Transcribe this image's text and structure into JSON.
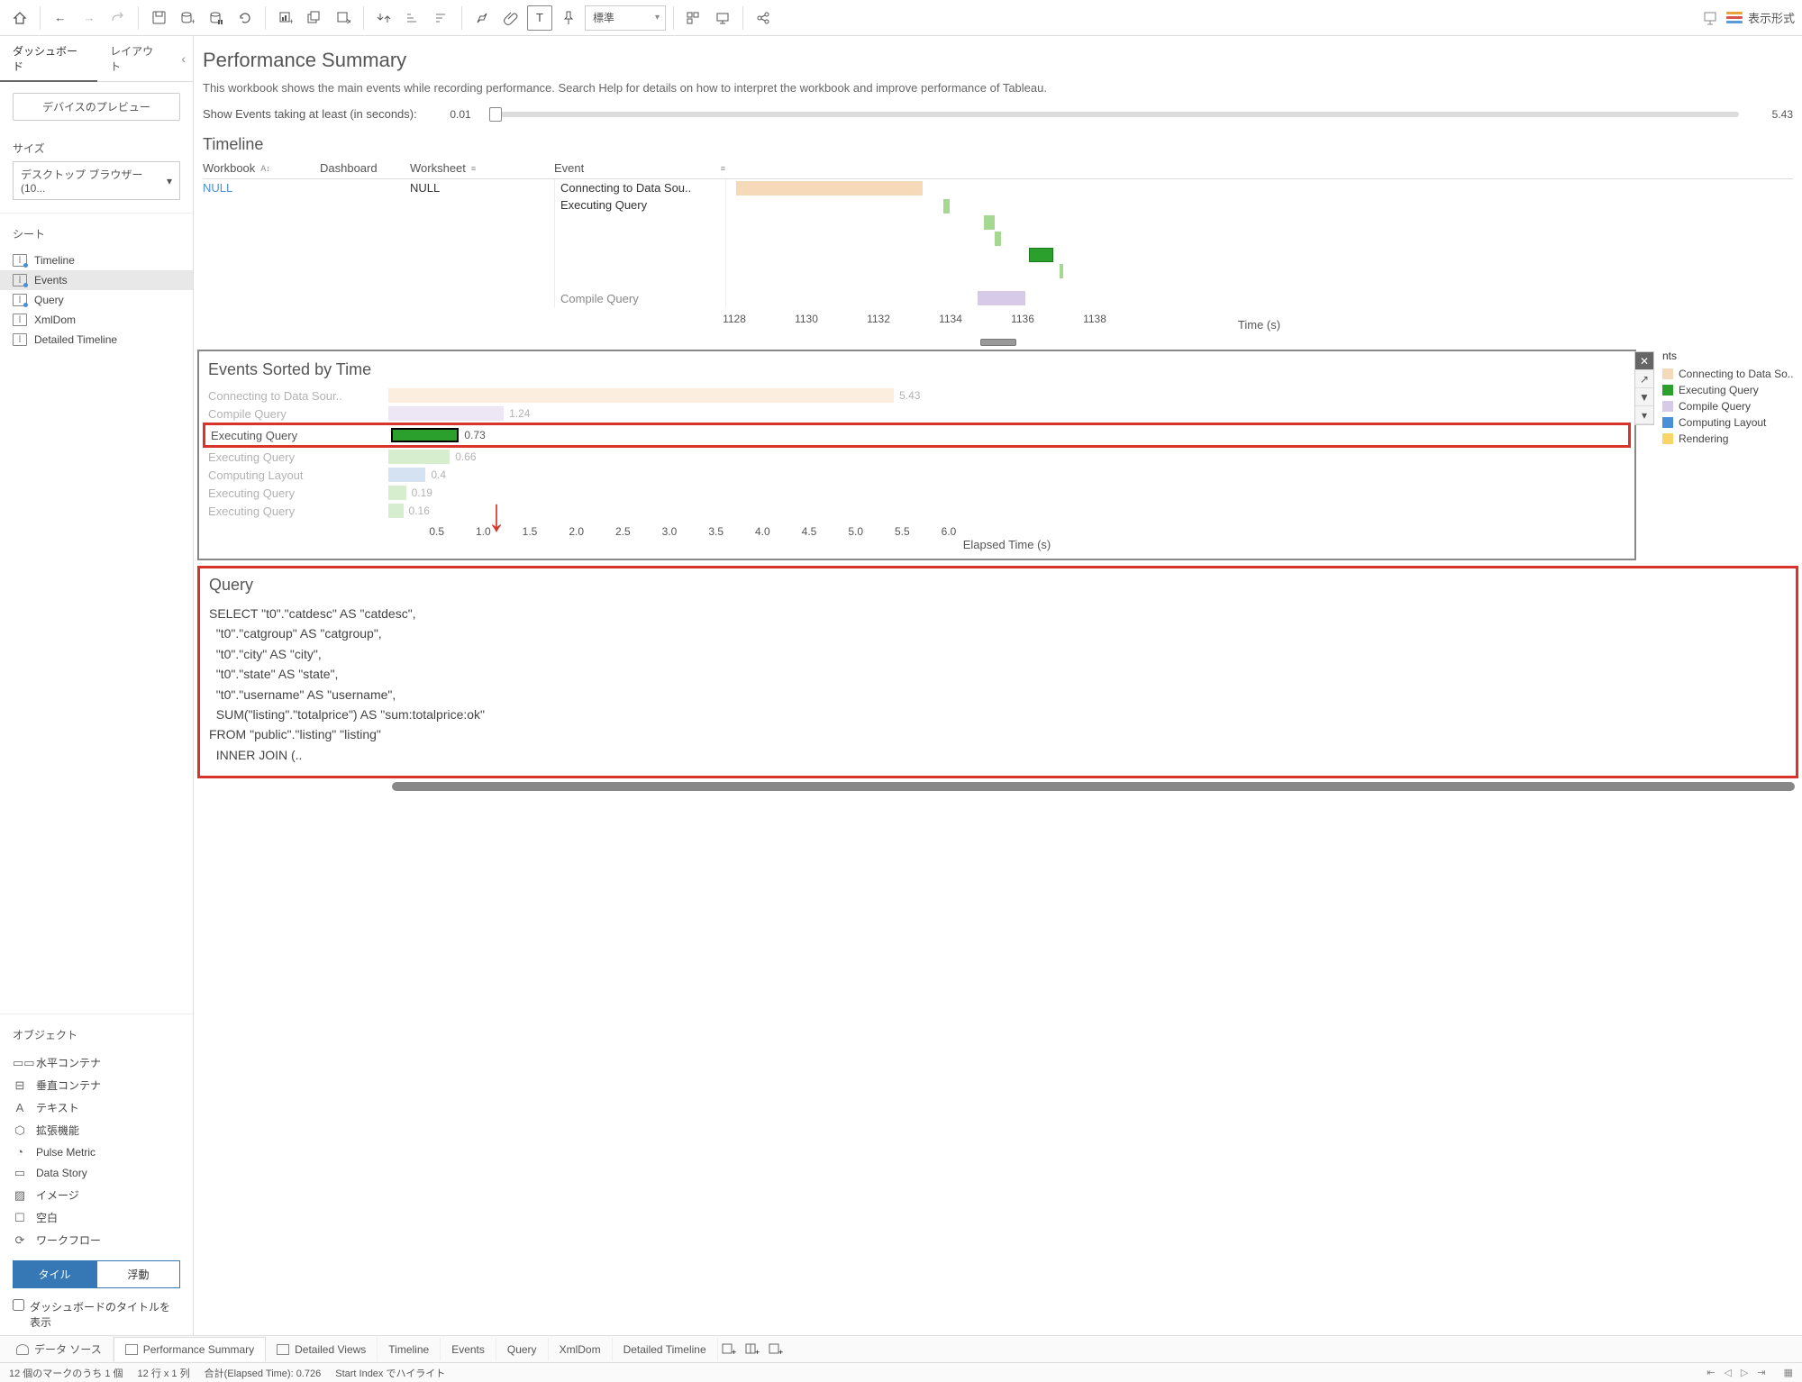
{
  "toolbar": {
    "std_label": "標準",
    "showme_label": "表示形式"
  },
  "sidebar": {
    "tabs": [
      "ダッシュボード",
      "レイアウト"
    ],
    "preview_btn": "デバイスのプレビュー",
    "size_label": "サイズ",
    "size_value": "デスクトップ ブラウザー (10...",
    "sheets_label": "シート",
    "sheets": [
      "Timeline",
      "Events",
      "Query",
      "XmlDom",
      "Detailed Timeline"
    ],
    "objects_label": "オブジェクト",
    "objects": [
      {
        "icon": "▭▭",
        "label": "水平コンテナ"
      },
      {
        "icon": "⊟",
        "label": "垂直コンテナ"
      },
      {
        "icon": "A",
        "label": "テキスト"
      },
      {
        "icon": "⬡",
        "label": "拡張機能"
      },
      {
        "icon": "◔",
        "label": "Pulse Metric"
      },
      {
        "icon": "▭",
        "label": "Data Story"
      },
      {
        "icon": "▨",
        "label": "イメージ"
      },
      {
        "icon": "☐",
        "label": "空白"
      },
      {
        "icon": "⟳",
        "label": "ワークフロー"
      }
    ],
    "tile": "タイル",
    "float": "浮動",
    "show_title": "ダッシュボードのタイトルを表示"
  },
  "dash": {
    "title": "Performance Summary",
    "desc": "This workbook shows the main events while recording performance. Search Help for details on how to interpret the workbook and improve performance of Tableau.",
    "slider_label": "Show Events taking at least (in seconds):",
    "slider_min": "0.01",
    "slider_max": "5.43"
  },
  "timeline": {
    "title": "Timeline",
    "cols": [
      "Workbook",
      "Dashboard",
      "Worksheet",
      "Event"
    ],
    "workbook": "NULL",
    "worksheet": "NULL",
    "events": [
      "Connecting to Data Sou..",
      "Executing Query",
      "Compile Query"
    ],
    "axis_label": "Time (s)",
    "ticks": [
      "1128",
      "1130",
      "1132",
      "1134",
      "1136",
      "1138"
    ]
  },
  "chart_data": {
    "timeline": {
      "type": "bar",
      "xlabel": "Time (s)",
      "xlim": [
        1127,
        1138
      ],
      "bars": [
        {
          "event": "Connecting to Data Source",
          "start": 1127.3,
          "end": 1132.7,
          "color": "#f5d9b8"
        },
        {
          "event": "Executing Query",
          "start": 1133.3,
          "end": 1133.5,
          "color": "#a5d991"
        },
        {
          "event": "Executing Query",
          "start": 1134.5,
          "end": 1134.8,
          "color": "#a5d991"
        },
        {
          "event": "Executing Query",
          "start": 1134.8,
          "end": 1135.0,
          "color": "#a5d991"
        },
        {
          "event": "Executing Query",
          "start": 1135.8,
          "end": 1136.5,
          "color": "#2ca02c"
        },
        {
          "event": "Executing Query",
          "start": 1136.7,
          "end": 1136.8,
          "color": "#a5d991"
        },
        {
          "event": "Compile Query",
          "start": 1134.3,
          "end": 1135.7,
          "color": "#d7c9e8"
        }
      ]
    },
    "events_sorted": {
      "type": "bar",
      "xlabel": "Elapsed Time (s)",
      "xlim": [
        0,
        6.0
      ],
      "ticks": [
        0.5,
        1.0,
        1.5,
        2.0,
        2.5,
        3.0,
        3.5,
        4.0,
        4.5,
        5.0,
        5.5,
        6.0
      ],
      "rows": [
        {
          "label": "Connecting to Data Sour..",
          "value": 5.43,
          "color": "#f5d9b8"
        },
        {
          "label": "Compile Query",
          "value": 1.24,
          "color": "#d7c9e8"
        },
        {
          "label": "Executing Query",
          "value": 0.73,
          "color": "#2ca02c",
          "highlighted": true
        },
        {
          "label": "Executing Query",
          "value": 0.66,
          "color": "#a5d991"
        },
        {
          "label": "Computing Layout",
          "value": 0.4,
          "color": "#9fbfe0"
        },
        {
          "label": "Executing Query",
          "value": 0.19,
          "color": "#a5d991"
        },
        {
          "label": "Executing Query",
          "value": 0.16,
          "color": "#a5d991"
        }
      ]
    }
  },
  "events_panel": {
    "title": "Events Sorted by Time",
    "axis_label": "Elapsed Time (s)",
    "legend_title": "nts",
    "legend": [
      {
        "color": "#f5d9b8",
        "label": "Connecting to Data So.."
      },
      {
        "color": "#2ca02c",
        "label": "Executing Query"
      },
      {
        "color": "#d7c9e8",
        "label": "Compile Query"
      },
      {
        "color": "#4a90d9",
        "label": "Computing Layout"
      },
      {
        "color": "#f8d568",
        "label": "Rendering"
      }
    ]
  },
  "query": {
    "title": "Query",
    "sql": "SELECT \"t0\".\"catdesc\" AS \"catdesc\",\n  \"t0\".\"catgroup\" AS \"catgroup\",\n  \"t0\".\"city\" AS \"city\",\n  \"t0\".\"state\" AS \"state\",\n  \"t0\".\"username\" AS \"username\",\n  SUM(\"listing\".\"totalprice\") AS \"sum:totalprice:ok\"\nFROM \"public\".\"listing\" \"listing\"\n  INNER JOIN (.."
  },
  "bottom": {
    "tabs": [
      "データ ソース",
      "Performance Summary",
      "Detailed Views",
      "Timeline",
      "Events",
      "Query",
      "XmlDom",
      "Detailed Timeline"
    ]
  },
  "status": {
    "marks": "12 個のマークのうち 1 個",
    "rows": "12 行  x  1 列",
    "sum": "合計(Elapsed Time): 0.726",
    "hl": "Start Index でハイライト"
  }
}
